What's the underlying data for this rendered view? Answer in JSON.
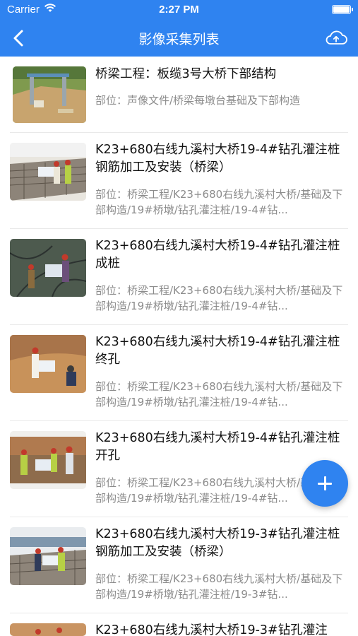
{
  "status_bar": {
    "carrier": "Carrier",
    "time": "2:27 PM"
  },
  "nav": {
    "title": "影像采集列表",
    "back_icon": "back-chevron-icon",
    "action_icon": "cloud-upload-icon"
  },
  "items": [
    {
      "title": "桥梁工程：板缆3号大桥下部结构",
      "location": "部位：声像文件/桥梁每墩台基础及下部构造"
    },
    {
      "title": "K23+680右线九溪村大桥19-4#钻孔灌注桩钢筋加工及安装（桥梁）",
      "location": "部位：桥梁工程/K23+680右线九溪村大桥/基础及下部构造/19#桥墩/钻孔灌注桩/19-4#钻..."
    },
    {
      "title": "K23+680右线九溪村大桥19-4#钻孔灌注桩成桩",
      "location": "部位：桥梁工程/K23+680右线九溪村大桥/基础及下部构造/19#桥墩/钻孔灌注桩/19-4#钻..."
    },
    {
      "title": "K23+680右线九溪村大桥19-4#钻孔灌注桩终孔",
      "location": "部位：桥梁工程/K23+680右线九溪村大桥/基础及下部构造/19#桥墩/钻孔灌注桩/19-4#钻..."
    },
    {
      "title": "K23+680右线九溪村大桥19-4#钻孔灌注桩开孔",
      "location": "部位：桥梁工程/K23+680右线九溪村大桥/基础及下部构造/19#桥墩/钻孔灌注桩/19-4#钻..."
    },
    {
      "title": "K23+680右线九溪村大桥19-3#钻孔灌注桩钢筋加工及安装（桥梁）",
      "location": "部位：桥梁工程/K23+680右线九溪村大桥/基础及下部构造/19#桥墩/钻孔灌注桩/19-3#钻..."
    },
    {
      "title": "K23+680右线九溪村大桥19-3#钻孔灌注",
      "location": ""
    }
  ],
  "fab": {
    "icon": "plus-icon"
  },
  "colors": {
    "primary": "#2f83f0",
    "title_text": "#111111",
    "secondary_text": "#8c8c8c"
  }
}
